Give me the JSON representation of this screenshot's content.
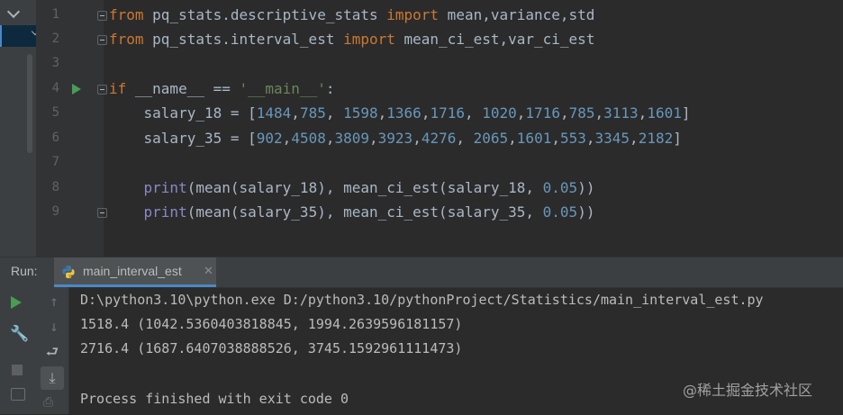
{
  "editor": {
    "line_numbers": [
      "1",
      "2",
      "3",
      "4",
      "5",
      "6",
      "7",
      "8",
      "9"
    ],
    "lines": [
      [
        {
          "t": "from",
          "c": "kw"
        },
        {
          "t": " pq_stats.descriptive_stats ",
          "c": ""
        },
        {
          "t": "import",
          "c": "kw"
        },
        {
          "t": " mean,variance,std",
          "c": ""
        }
      ],
      [
        {
          "t": "from",
          "c": "kw"
        },
        {
          "t": " pq_stats.interval_est ",
          "c": ""
        },
        {
          "t": "import",
          "c": "kw"
        },
        {
          "t": " mean_ci_est,var_ci_est",
          "c": ""
        }
      ],
      [],
      [
        {
          "t": "if",
          "c": "kw"
        },
        {
          "t": " __name__ == ",
          "c": ""
        },
        {
          "t": "'__main__'",
          "c": "str"
        },
        {
          "t": ":",
          "c": ""
        }
      ],
      [
        {
          "t": "    salary_18 = [",
          "c": ""
        },
        {
          "t": "1484",
          "c": "num"
        },
        {
          "t": ",",
          "c": ""
        },
        {
          "t": "785",
          "c": "num"
        },
        {
          "t": ", ",
          "c": ""
        },
        {
          "t": "1598",
          "c": "num"
        },
        {
          "t": ",",
          "c": ""
        },
        {
          "t": "1366",
          "c": "num"
        },
        {
          "t": ",",
          "c": ""
        },
        {
          "t": "1716",
          "c": "num"
        },
        {
          "t": ", ",
          "c": ""
        },
        {
          "t": "1020",
          "c": "num"
        },
        {
          "t": ",",
          "c": ""
        },
        {
          "t": "1716",
          "c": "num"
        },
        {
          "t": ",",
          "c": ""
        },
        {
          "t": "785",
          "c": "num"
        },
        {
          "t": ",",
          "c": ""
        },
        {
          "t": "3113",
          "c": "num"
        },
        {
          "t": ",",
          "c": ""
        },
        {
          "t": "1601",
          "c": "num"
        },
        {
          "t": "]",
          "c": ""
        }
      ],
      [
        {
          "t": "    salary_35 = [",
          "c": ""
        },
        {
          "t": "902",
          "c": "num"
        },
        {
          "t": ",",
          "c": ""
        },
        {
          "t": "4508",
          "c": "num"
        },
        {
          "t": ",",
          "c": ""
        },
        {
          "t": "3809",
          "c": "num"
        },
        {
          "t": ",",
          "c": ""
        },
        {
          "t": "3923",
          "c": "num"
        },
        {
          "t": ",",
          "c": ""
        },
        {
          "t": "4276",
          "c": "num"
        },
        {
          "t": ", ",
          "c": ""
        },
        {
          "t": "2065",
          "c": "num"
        },
        {
          "t": ",",
          "c": ""
        },
        {
          "t": "1601",
          "c": "num"
        },
        {
          "t": ",",
          "c": ""
        },
        {
          "t": "553",
          "c": "num"
        },
        {
          "t": ",",
          "c": ""
        },
        {
          "t": "3345",
          "c": "num"
        },
        {
          "t": ",",
          "c": ""
        },
        {
          "t": "2182",
          "c": "num"
        },
        {
          "t": "]",
          "c": ""
        }
      ],
      [],
      [
        {
          "t": "    ",
          "c": ""
        },
        {
          "t": "print",
          "c": "bi"
        },
        {
          "t": "(mean(salary_18), mean_ci_est(salary_18, ",
          "c": ""
        },
        {
          "t": "0.05",
          "c": "num"
        },
        {
          "t": "))",
          "c": ""
        }
      ],
      [
        {
          "t": "    ",
          "c": ""
        },
        {
          "t": "print",
          "c": "bi"
        },
        {
          "t": "(mean(salary_35), mean_ci_est(salary_35, ",
          "c": ""
        },
        {
          "t": "0.05",
          "c": "num"
        },
        {
          "t": "))",
          "c": ""
        }
      ]
    ]
  },
  "run": {
    "label": "Run:",
    "tab_label": "main_interval_est",
    "output": [
      "D:\\python3.10\\python.exe D:/python3.10/pythonProject/Statistics/main_interval_est.py",
      "1518.4 (1042.5360403818845, 1994.2639596181157)",
      "2716.4 (1687.6407038888526, 3745.1592961111473)",
      "",
      "Process finished with exit code 0"
    ]
  },
  "watermark": "@稀土掘金技术社区",
  "colors": {
    "keyword": "#cc7832",
    "number": "#6897bb",
    "string": "#6a8759",
    "builtin": "#8888c6",
    "run_green": "#499c54",
    "accent": "#4a88c7"
  }
}
